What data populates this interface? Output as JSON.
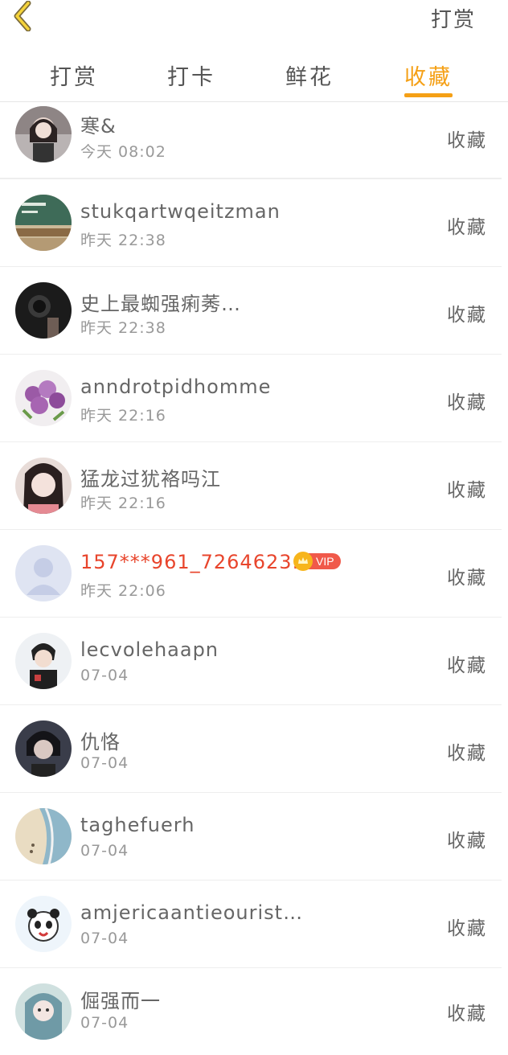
{
  "header": {
    "back_icon": "chevron-left-icon",
    "action_label": "打赏",
    "accent_color": "#f5a016"
  },
  "tabs": [
    {
      "label": "打赏",
      "active": false
    },
    {
      "label": "打卡",
      "active": false
    },
    {
      "label": "鲜花",
      "active": false
    },
    {
      "label": "收藏",
      "active": true
    }
  ],
  "list": [
    {
      "name": "寒&",
      "time": "今天 08:02",
      "action": "收藏",
      "vip": false
    },
    {
      "name": "stukqartwqeitzman",
      "time": "昨天 22:38",
      "action": "收藏",
      "vip": false
    },
    {
      "name": "史上最蜘强痢莠…",
      "time": "昨天 22:38",
      "action": "收藏",
      "vip": false
    },
    {
      "name": "anndrotpidhomme",
      "time": "昨天 22:16",
      "action": "收藏",
      "vip": false
    },
    {
      "name": "猛龙过犹袼吗江",
      "time": "昨天 22:16",
      "action": "收藏",
      "vip": false
    },
    {
      "name": "157***961_7264623…",
      "time": "昨天 22:06",
      "action": "收藏",
      "vip": true,
      "vip_label": "VIP"
    },
    {
      "name": "lecvolehaapn",
      "time": "07-04",
      "action": "收藏",
      "vip": false
    },
    {
      "name": "仇恪",
      "time": "07-04",
      "action": "收藏",
      "vip": false
    },
    {
      "name": "taghefuerh",
      "time": "07-04",
      "action": "收藏",
      "vip": false
    },
    {
      "name": "amjericaantieourist…",
      "time": "07-04",
      "action": "收藏",
      "vip": false
    },
    {
      "name": "倔强而一",
      "time": "07-04",
      "action": "收藏",
      "vip": false
    }
  ]
}
